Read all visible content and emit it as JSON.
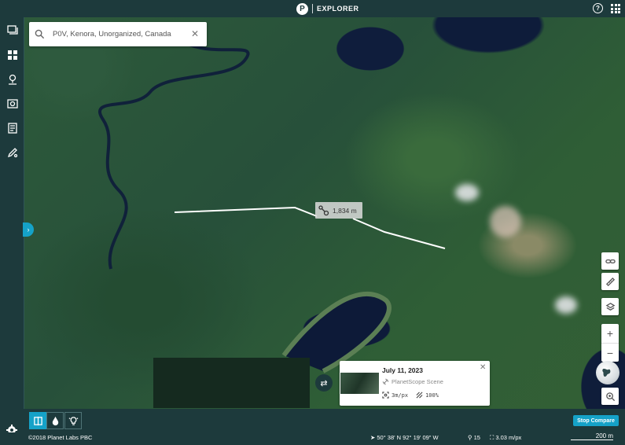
{
  "app": {
    "name": "EXPLORER",
    "logo_letter": "P"
  },
  "header": {
    "help_icon": "help-circle-icon",
    "apps_icon": "apps-grid-icon",
    "help_glyph": "?"
  },
  "sidebar": {
    "items": [
      {
        "icon": "layers-stack-icon"
      },
      {
        "icon": "mosaic-grid-icon"
      },
      {
        "icon": "location-pin-icon"
      },
      {
        "icon": "image-search-icon"
      },
      {
        "icon": "document-list-icon"
      },
      {
        "icon": "drawing-tool-icon"
      }
    ],
    "toggle_glyph": "›"
  },
  "search": {
    "value": "P0V, Kenora, Unorganized, Canada",
    "clear_glyph": "✕"
  },
  "measurement": {
    "distance_label": "1,834 m"
  },
  "right_tools": {
    "link_icon": "link-icon",
    "ruler_icon": "ruler-icon",
    "layers_icon": "layers-icon",
    "zoom_in": "+",
    "zoom_out": "−",
    "zoom_search_icon": "magnifier-icon"
  },
  "compare": {
    "swap_glyph": "⇄",
    "scene": {
      "date": "July 11, 2023",
      "type": "PlanetScope Scene",
      "resolution": "3m/px",
      "coverage": "100%",
      "close_glyph": "✕"
    },
    "stop_label": "Stop Compare"
  },
  "bottom_modes": [
    {
      "icon": "split-view-icon",
      "active": true
    },
    {
      "icon": "opacity-drop-icon",
      "active": false
    },
    {
      "icon": "lightbulb-icon",
      "active": false
    }
  ],
  "status": {
    "copyright": "©2018 Planet Labs PBC",
    "coordinates": "50° 38' N 92° 19' 09\" W",
    "zoom_level": "15",
    "resolution": "3.03 m/px",
    "scale": "200 m"
  },
  "colors": {
    "accent": "#15a2c8",
    "chrome": "#1d3a3c"
  }
}
